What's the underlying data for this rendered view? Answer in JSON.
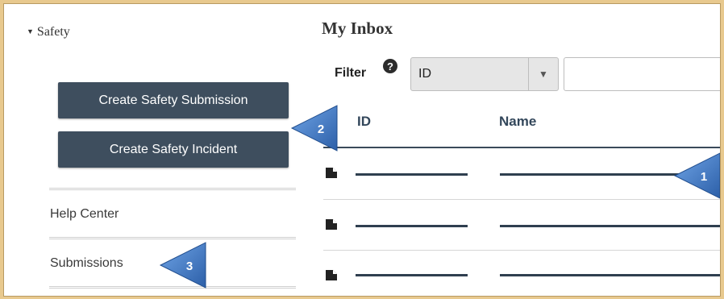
{
  "sidebar": {
    "section_label": "Safety",
    "create_submission_label": "Create Safety Submission",
    "create_incident_label": "Create Safety Incident",
    "help_center_label": "Help Center",
    "submissions_label": "Submissions"
  },
  "inbox": {
    "title": "My Inbox",
    "filter_label": "Filter",
    "filter_help_icon": "?",
    "filter_select_value": "ID",
    "filter_text_value": "",
    "columns": [
      "ID",
      "Name"
    ]
  },
  "callouts": [
    "1",
    "2",
    "3"
  ],
  "icons": {
    "section_toggle": "caret-down-icon",
    "help": "question-circle-icon",
    "select_arrow": "chevron-down-icon",
    "row": "document-icon"
  },
  "colors": {
    "button_bg": "#3e4e5e",
    "callout_blue": "#3b74c4",
    "page_border": "#e8c98e"
  }
}
